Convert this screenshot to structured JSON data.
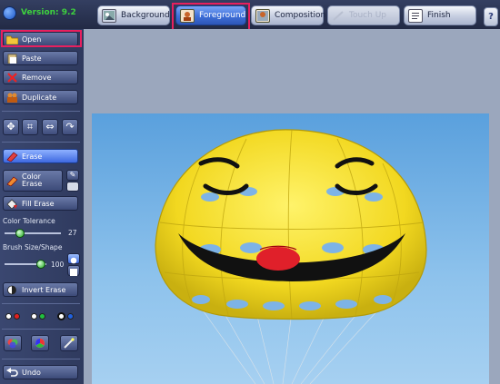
{
  "app": {
    "version": "Version: 9.2"
  },
  "tabs": [
    {
      "label": "Background",
      "icon": "background-icon",
      "state": "normal"
    },
    {
      "label": "Foreground",
      "icon": "foreground-icon",
      "state": "active"
    },
    {
      "label": "Composition",
      "icon": "composition-icon",
      "state": "normal"
    },
    {
      "label": "Touch Up",
      "icon": "touch-up-icon",
      "state": "disabled"
    },
    {
      "label": "Finish",
      "icon": "finish-icon",
      "state": "normal"
    }
  ],
  "help_label": "?",
  "sidebar": {
    "file_buttons": {
      "open": "Open",
      "paste": "Paste",
      "remove": "Remove",
      "duplicate": "Duplicate"
    },
    "tool_icons": [
      "move-icon",
      "crop-icon",
      "flip-icon",
      "rotate-icon"
    ],
    "erase_buttons": {
      "erase": "Erase",
      "color_erase_line1": "Color",
      "color_erase_line2": "Erase",
      "fill_erase": "Fill Erase"
    },
    "color_tolerance": {
      "label": "Color Tolerance",
      "value": "27",
      "fraction": 0.2
    },
    "brush_size": {
      "label": "Brush Size/Shape",
      "value": "100",
      "fraction": 0.7
    },
    "invert_erase": "Invert Erase",
    "color_swatches": [
      "#e02020",
      "#20c040",
      "#2060e0"
    ],
    "bottom_icons": [
      "layers-icon",
      "color-wheel-icon",
      "wand-icon"
    ],
    "undo": "Undo"
  },
  "colors": {
    "accent_active": "#3e6fd8",
    "highlight": "#e8205f",
    "version_green": "#3ed33e"
  }
}
